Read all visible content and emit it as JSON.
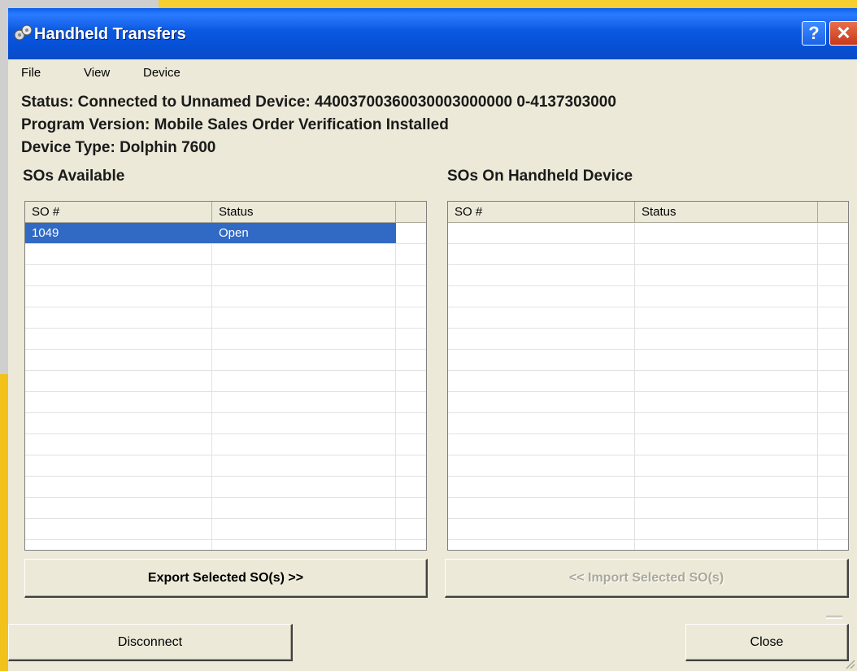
{
  "window": {
    "title": "Handheld Transfers",
    "help_label": "?",
    "close_label": "✕"
  },
  "menu": {
    "items": [
      "File",
      "View",
      "Device"
    ]
  },
  "info": {
    "status": "Status: Connected to Unnamed Device: 44003700360030003000000 0-4137303000",
    "program_version": "Program Version:  Mobile Sales Order Verification Installed",
    "device_type": "Device Type: Dolphin 7600"
  },
  "available": {
    "title": "SOs Available",
    "columns": [
      "SO #",
      "Status"
    ],
    "rows": [
      {
        "so": "1049",
        "status": "Open",
        "selected": true
      }
    ]
  },
  "handheld": {
    "title": "SOs On Handheld Device",
    "columns": [
      "SO #",
      "Status"
    ],
    "rows": []
  },
  "buttons": {
    "export": "Export Selected SO(s) >>",
    "import": "<< Import Selected SO(s)",
    "disconnect": "Disconnect",
    "close": "Close"
  },
  "colors": {
    "selection": "#316AC5",
    "titlebar": "#0A5FEA",
    "window_bg": "#ECE9D8",
    "desktop": "#F5C51B"
  }
}
